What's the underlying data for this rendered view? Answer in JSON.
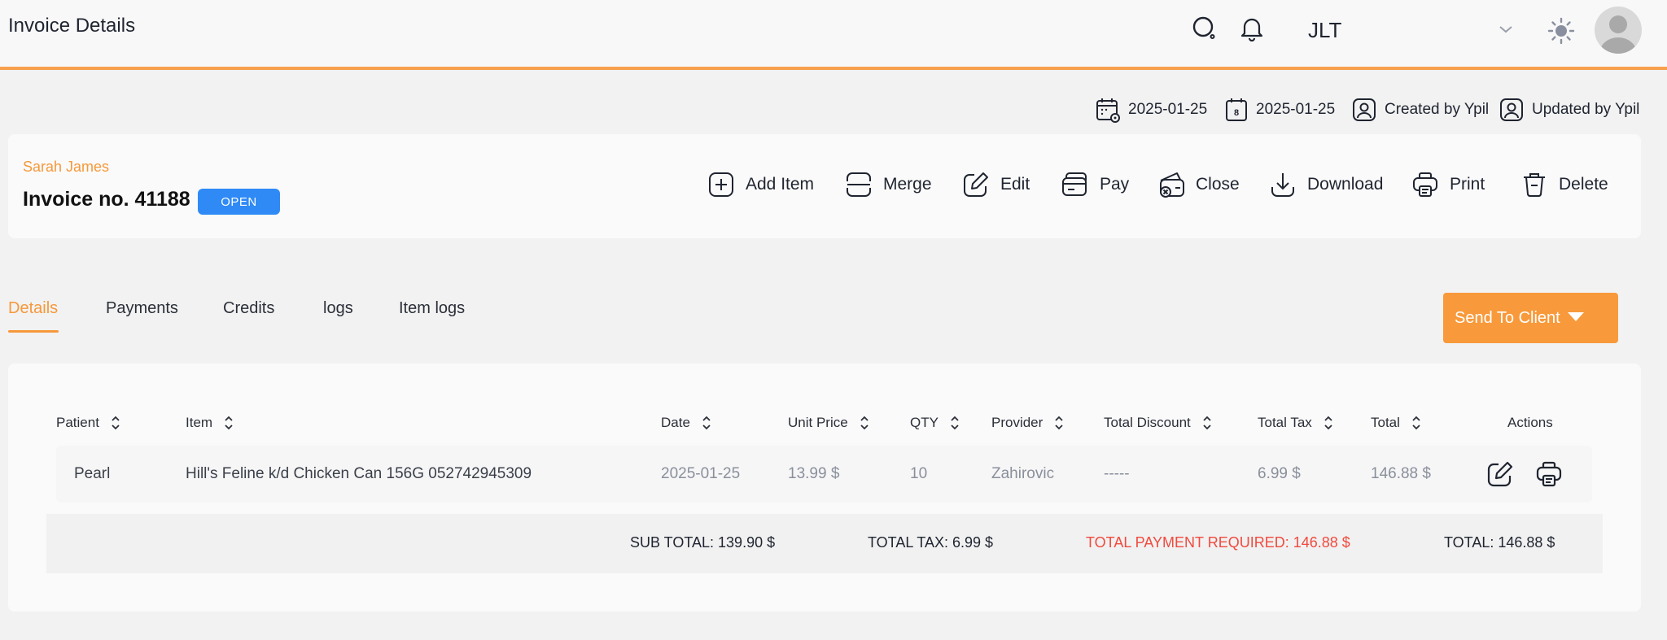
{
  "header": {
    "title": "Invoice Details",
    "clinic": "JLT",
    "icons": [
      "search-icon",
      "bell-icon",
      "chevron-down-icon",
      "sun-icon",
      "avatar"
    ]
  },
  "meta": {
    "created_date": "2025-01-25",
    "updated_date": "2025-01-25",
    "created_by": "Created by Ypil",
    "updated_by": "Updated by Ypil",
    "calendar_day_glyph": "8"
  },
  "invoice": {
    "client_name": "Sarah James",
    "invoice_no": "Invoice no. 41188",
    "status": "OPEN"
  },
  "actions": {
    "add_item": "Add Item",
    "merge": "Merge",
    "edit": "Edit",
    "pay": "Pay",
    "close": "Close",
    "download": "Download",
    "print": "Print",
    "delete": "Delete"
  },
  "tabs": {
    "details": "Details",
    "payments": "Payments",
    "credits": "Credits",
    "logs": "logs",
    "item_logs": "Item logs",
    "active": "Details"
  },
  "send_button": "Send To Client",
  "table": {
    "columns": {
      "patient": "Patient",
      "item": "Item",
      "date": "Date",
      "unit_price": "Unit Price",
      "qty": "QTY",
      "provider": "Provider",
      "total_discount": "Total Discount",
      "total_tax": "Total Tax",
      "total": "Total",
      "actions": "Actions"
    },
    "rows": [
      {
        "patient": "Pearl",
        "item": "Hill's Feline k/d Chicken Can 156G 052742945309",
        "date": "2025-01-25",
        "unit_price": "13.99 $",
        "qty": "10",
        "provider": "Zahirovic",
        "total_discount": "-----",
        "total_tax": "6.99 $",
        "total": "146.88 $"
      }
    ]
  },
  "totals": {
    "sub_total": "SUB TOTAL: 139.90 $",
    "total_tax": "TOTAL TAX: 6.99 $",
    "payment_required": "TOTAL PAYMENT REQUIRED: 146.88 $",
    "total": "TOTAL: 146.88 $"
  },
  "colors": {
    "accent": "#f7983a",
    "status_badge": "#2f8af5",
    "payment_required": "#f04a3e"
  }
}
